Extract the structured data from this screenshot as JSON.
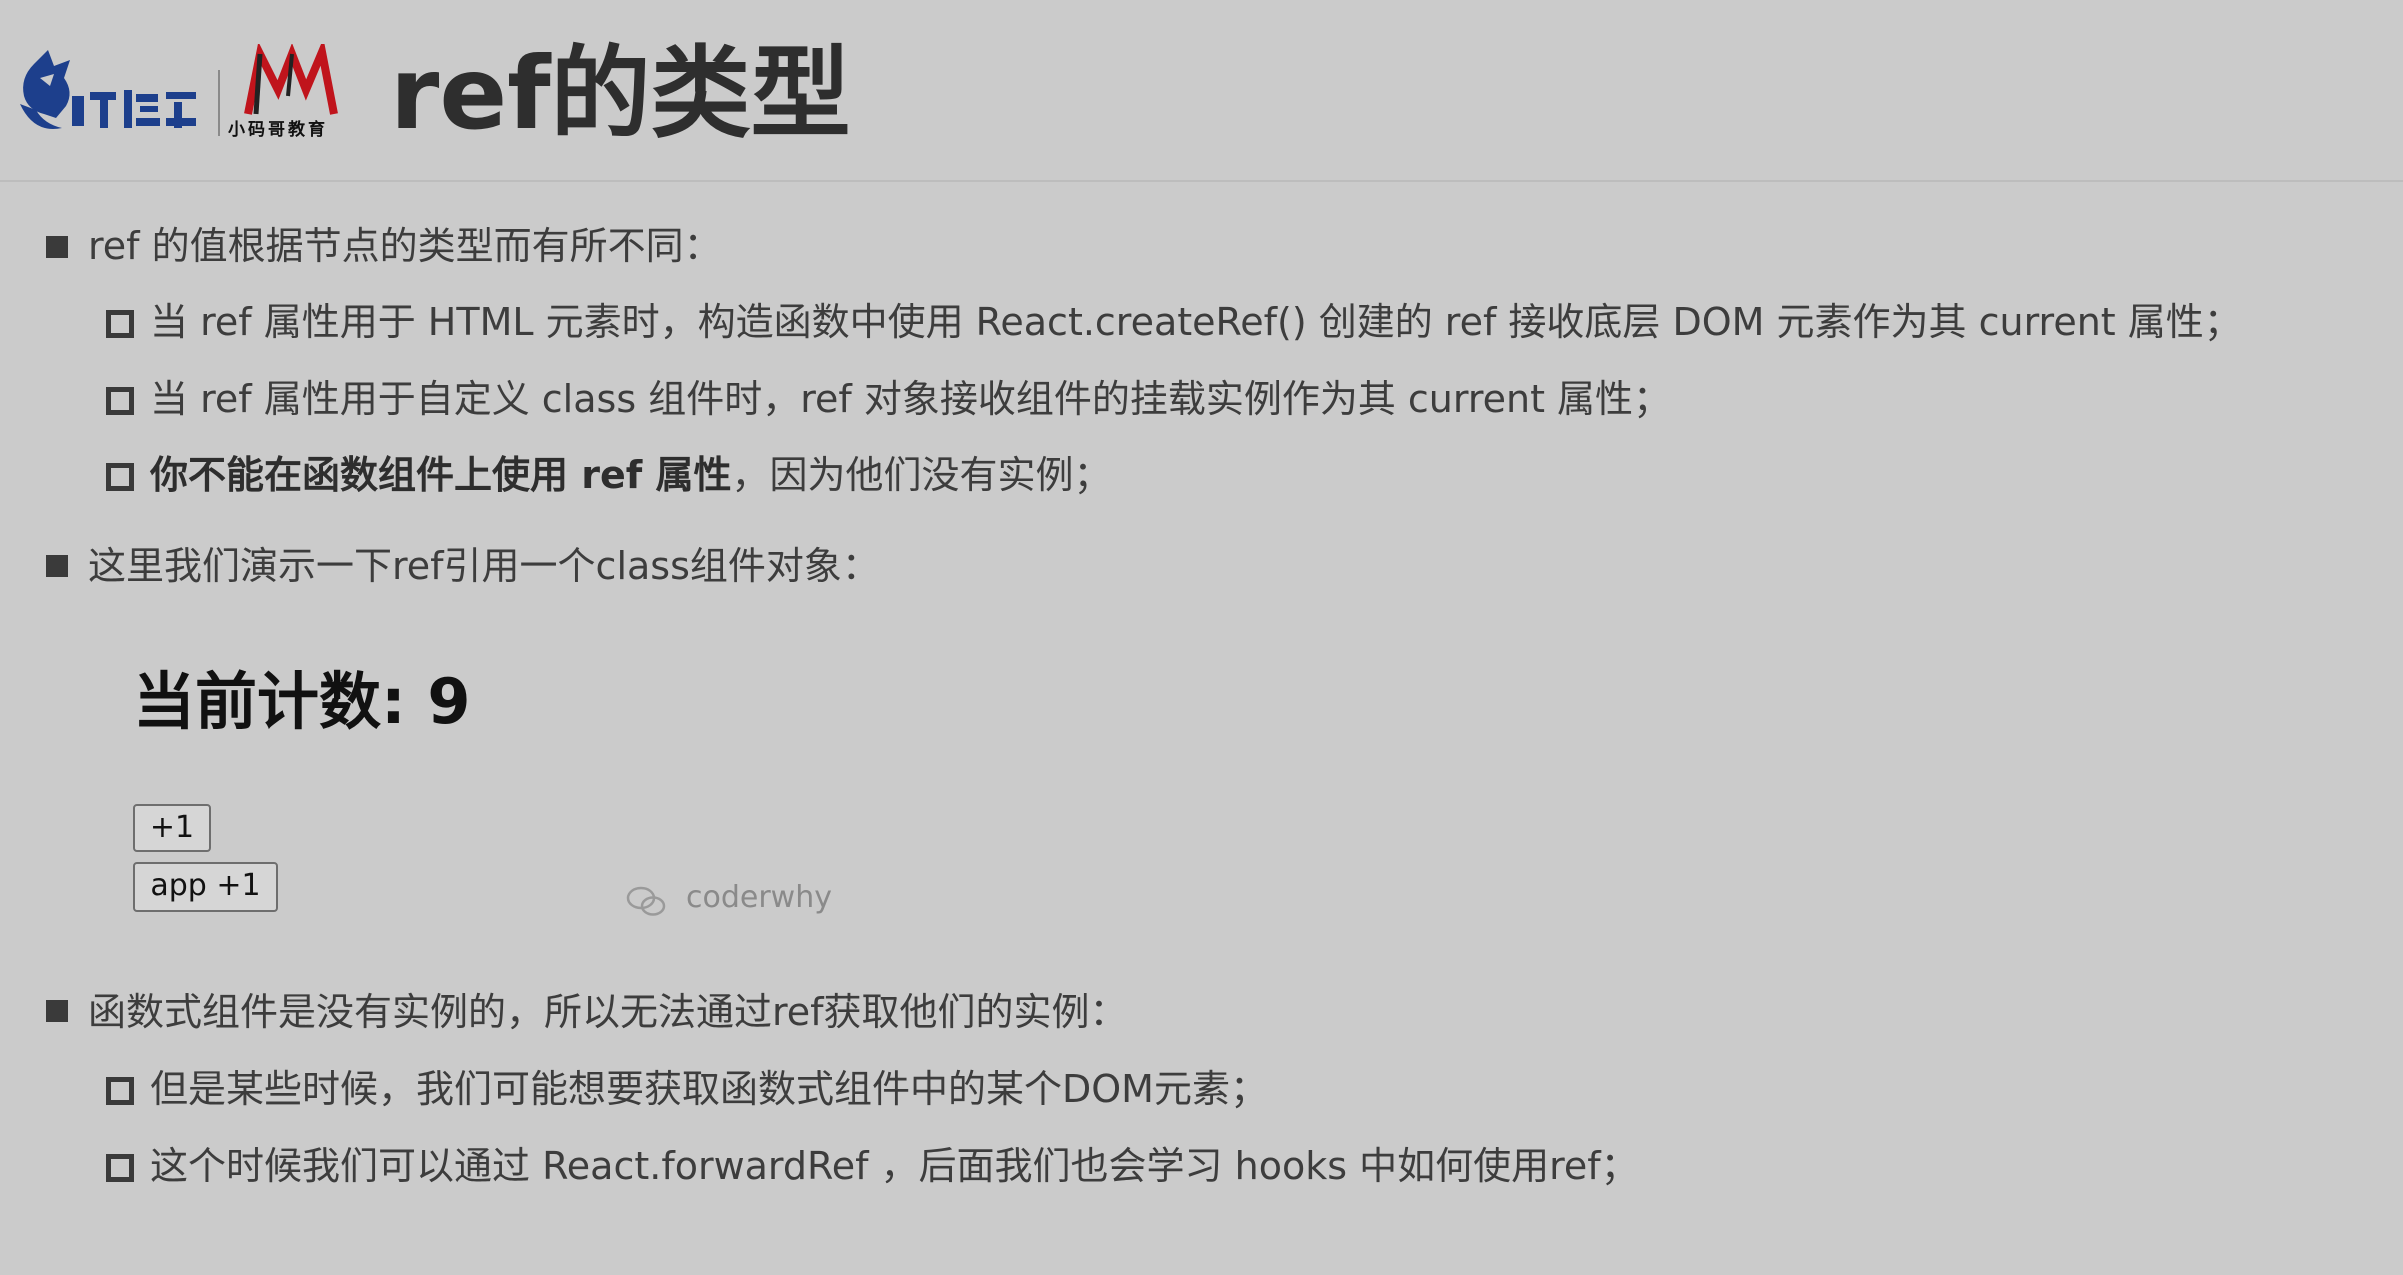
{
  "header": {
    "logo_text": "小码哥教育",
    "title": "ref的类型"
  },
  "content": {
    "item1": {
      "text": "ref 的值根据节点的类型而有所不同："
    },
    "sub1": {
      "text": "当 ref 属性用于 HTML 元素时，构造函数中使用 React.createRef() 创建的 ref 接收底层 DOM 元素作为其 current 属性；"
    },
    "sub2": {
      "text": "当 ref 属性用于自定义 class 组件时，ref 对象接收组件的挂载实例作为其 current 属性；"
    },
    "sub3": {
      "bold": "你不能在函数组件上使用 ref 属性",
      "text": "，因为他们没有实例；"
    },
    "item2": {
      "text": "这里我们演示一下ref引用一个class组件对象："
    },
    "demo": {
      "count_text": "当前计数: 9",
      "btn_plus": "+1",
      "btn_app_plus": "app +1",
      "watermark": "coderwhy"
    },
    "item3": {
      "text": "函数式组件是没有实例的，所以无法通过ref获取他们的实例："
    },
    "sub4": {
      "text": "但是某些时候，我们可能想要获取函数式组件中的某个DOM元素；"
    },
    "sub5": {
      "text": "这个时候我们可以通过 React.forwardRef ，后面我们也会学习 hooks 中如何使用ref；"
    }
  }
}
